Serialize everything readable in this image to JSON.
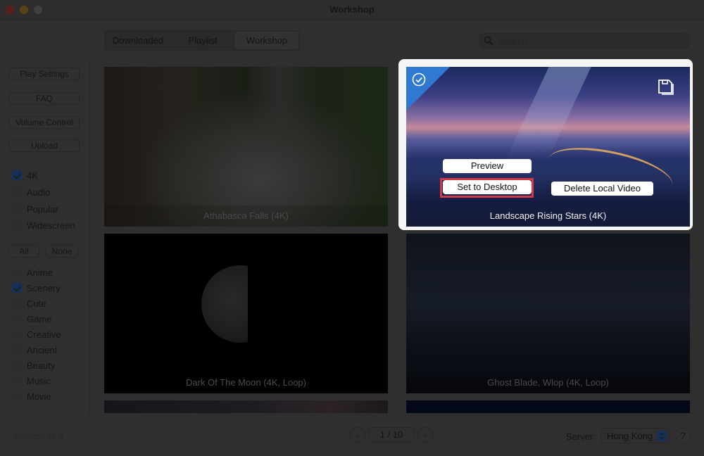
{
  "window": {
    "title": "Workshop"
  },
  "tabs": [
    {
      "label": "Downloaded",
      "selected": false
    },
    {
      "label": "Playlist",
      "selected": false
    },
    {
      "label": "Workshop",
      "selected": true
    }
  ],
  "search": {
    "placeholder": "Search",
    "value": ""
  },
  "sidebar": {
    "buttons": [
      {
        "label": "Play Settings"
      },
      {
        "label": "FAQ"
      },
      {
        "label": "Volume Control"
      },
      {
        "label": "Upload"
      }
    ],
    "quality_filters": [
      {
        "label": "4K",
        "checked": true
      },
      {
        "label": "Audio",
        "checked": false
      },
      {
        "label": "Popular",
        "checked": false
      },
      {
        "label": "Widescreen",
        "checked": false
      }
    ],
    "all_label": "All",
    "none_label": "None",
    "categories": [
      {
        "label": "Anime",
        "checked": false
      },
      {
        "label": "Scenery",
        "checked": true
      },
      {
        "label": "Cute",
        "checked": false
      },
      {
        "label": "Game",
        "checked": false
      },
      {
        "label": "Creative",
        "checked": false
      },
      {
        "label": "Ancient",
        "checked": false
      },
      {
        "label": "Beauty",
        "checked": false
      },
      {
        "label": "Music",
        "checked": false
      },
      {
        "label": "Movie",
        "checked": false
      }
    ]
  },
  "wallpapers": [
    {
      "title": "Athabasca Falls (4K)",
      "highlighted": false
    },
    {
      "title": "Landscape Rising Stars (4K)",
      "highlighted": true,
      "selected": true,
      "downloaded": true,
      "actions": {
        "preview": "Preview",
        "set_desktop": "Set to Desktop",
        "delete_local": "Delete Local Video"
      }
    },
    {
      "title": "Dark Of The Moon (4K, Loop)",
      "highlighted": false
    },
    {
      "title": "Ghost Blade, Wlop (4K, Loop)",
      "highlighted": false
    }
  ],
  "colors": {
    "highlight_frame": "#f5f5f5",
    "selected_corner": "#2f7ad0",
    "callout_outline": "#d13a48"
  },
  "footer": {
    "version": "Version: 15.6",
    "page": "1 / 10",
    "prev_icon": "«",
    "next_icon": "»",
    "server_label": "Server:",
    "server_value": "Hong Kong",
    "help_label": "?"
  }
}
